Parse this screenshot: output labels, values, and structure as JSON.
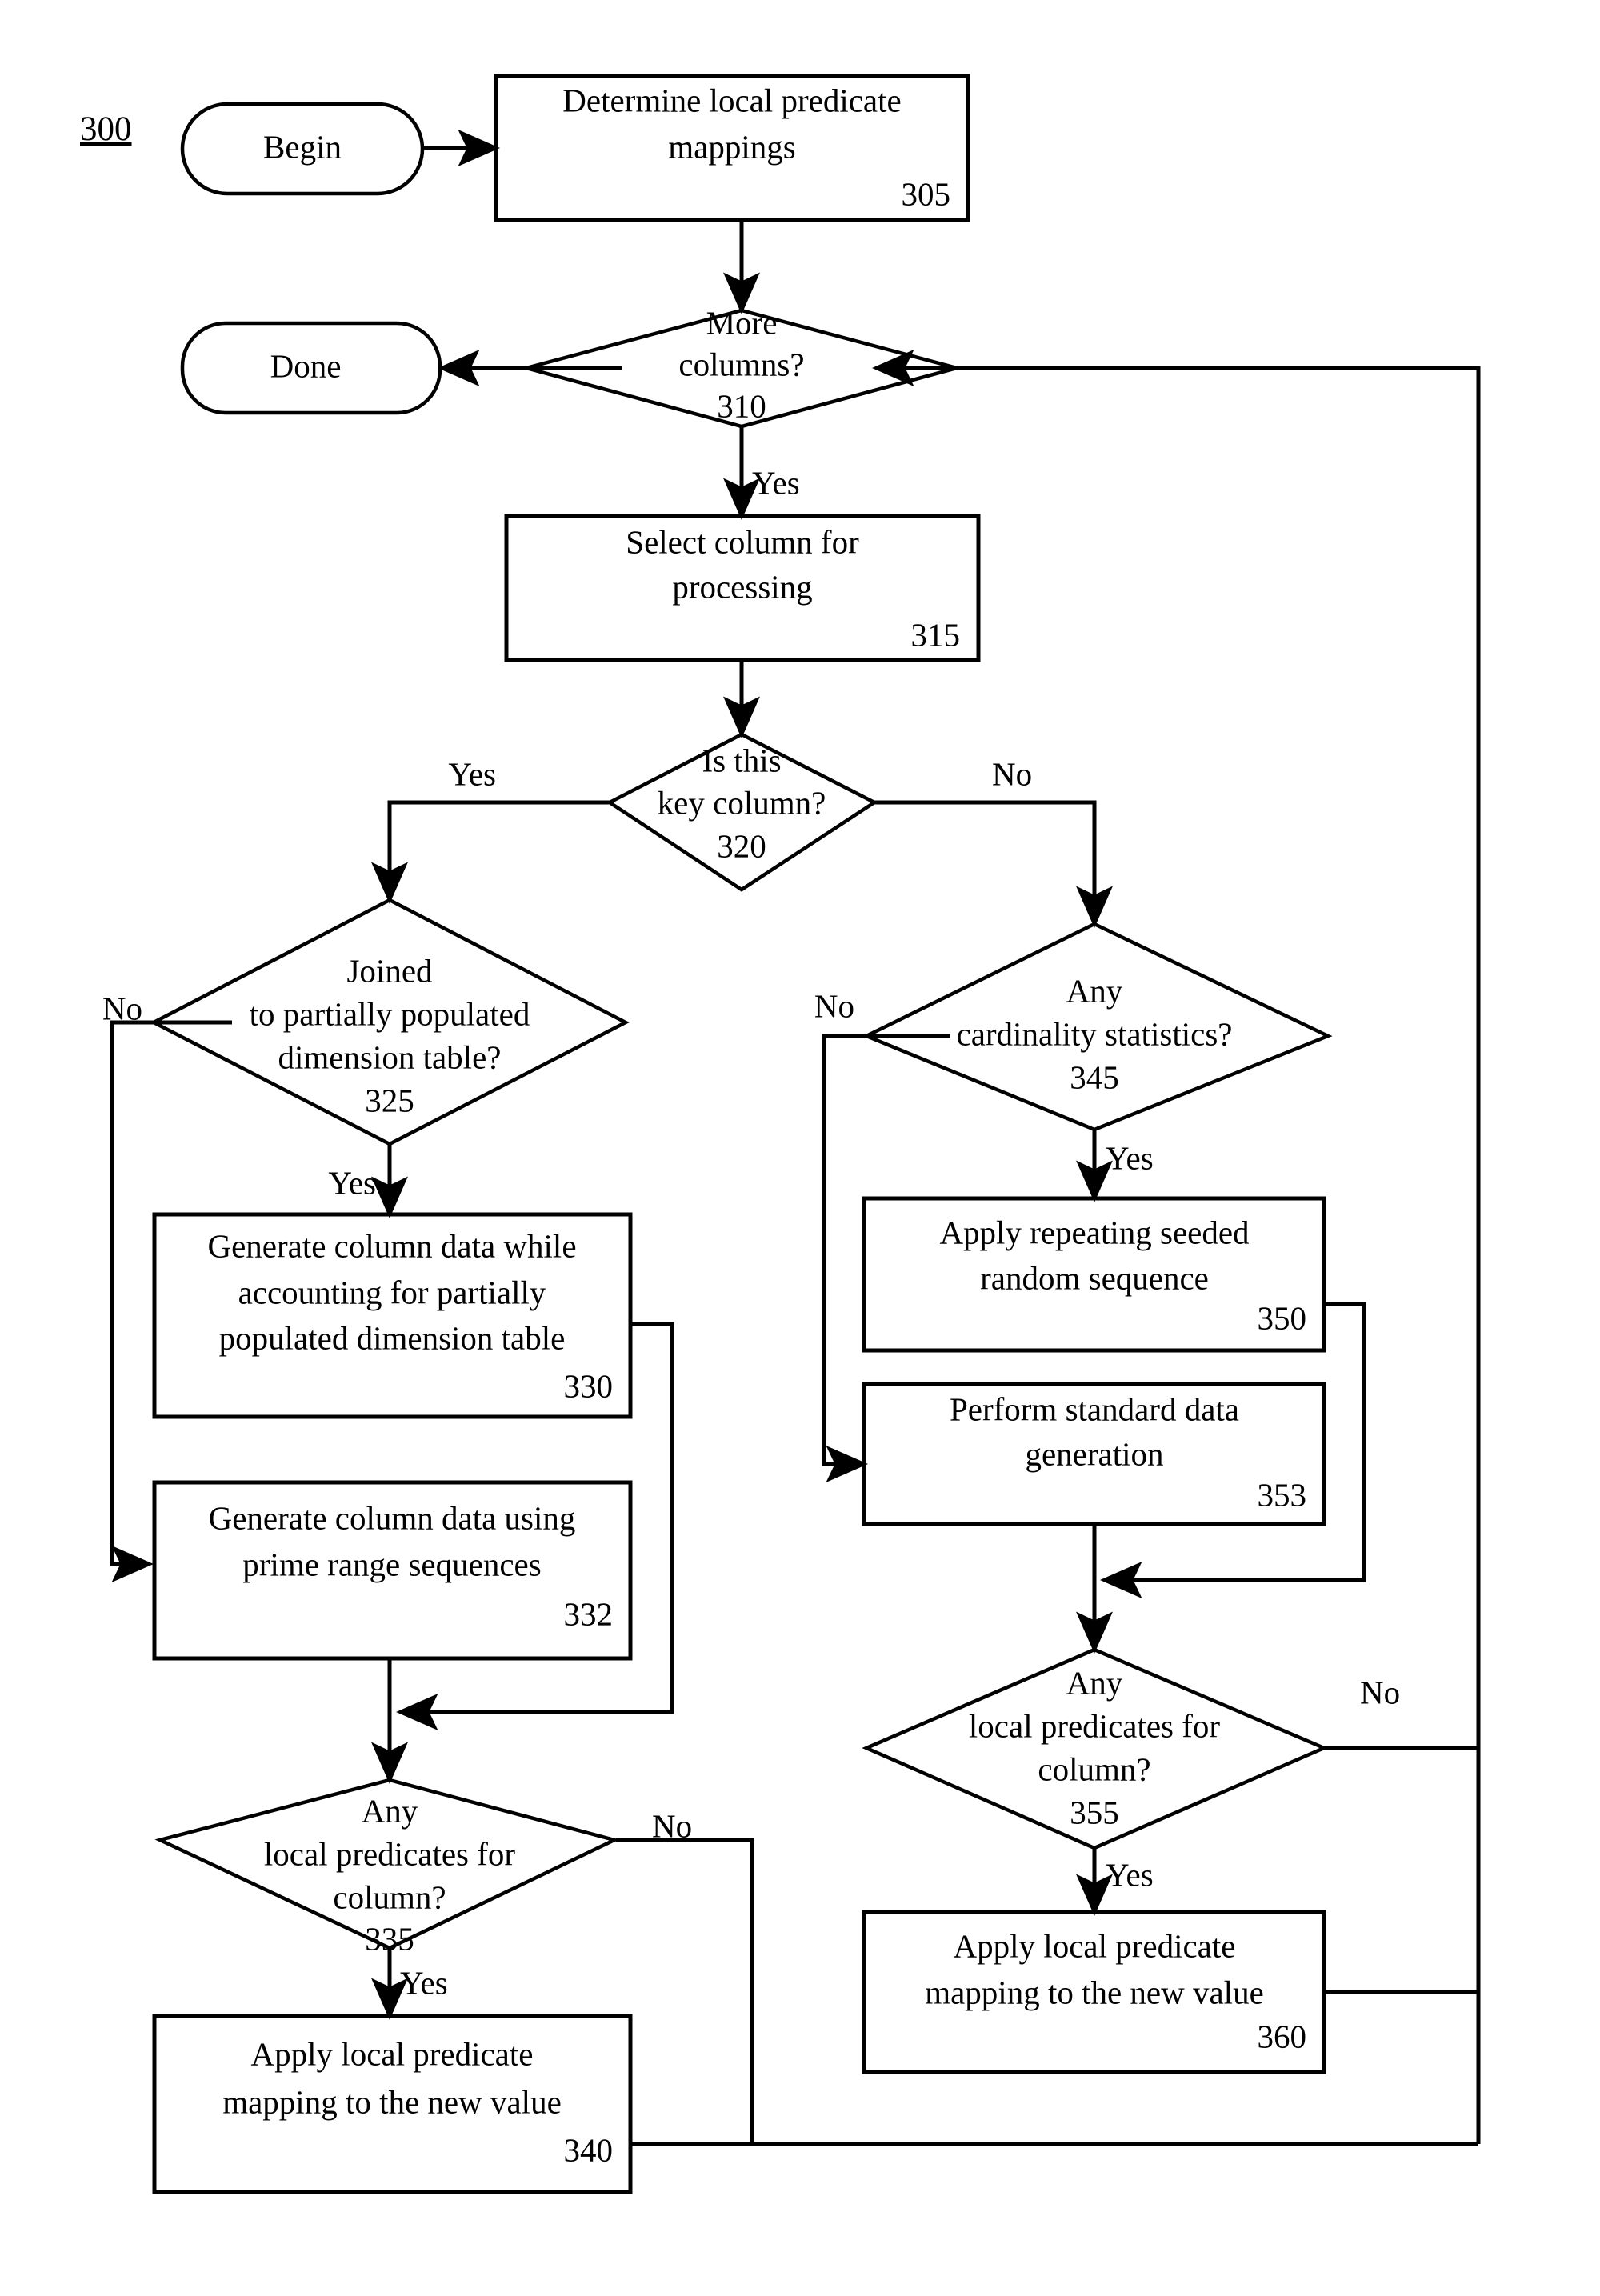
{
  "figure": {
    "label": "300",
    "title_text": ""
  },
  "nodes": {
    "begin": {
      "id": "begin",
      "kind": "terminator",
      "label": "Begin",
      "ref": ""
    },
    "done": {
      "id": "done",
      "kind": "terminator",
      "label": "Done",
      "ref": ""
    },
    "n305": {
      "id": "305",
      "kind": "process",
      "lines": [
        "Determine local predicate",
        "mappings"
      ],
      "ref": "305"
    },
    "n310": {
      "id": "310",
      "kind": "decision",
      "lines": [
        "More",
        "columns?"
      ],
      "ref": "310"
    },
    "n315": {
      "id": "315",
      "kind": "process",
      "lines": [
        "Select column for",
        "processing"
      ],
      "ref": "315"
    },
    "n320": {
      "id": "320",
      "kind": "decision",
      "lines": [
        "Is this",
        "key column?"
      ],
      "ref": "320"
    },
    "n325": {
      "id": "325",
      "kind": "decision",
      "lines": [
        "Joined",
        "to partially populated",
        "dimension table?"
      ],
      "ref": "325"
    },
    "n330": {
      "id": "330",
      "kind": "process",
      "lines": [
        "Generate column data while",
        "accounting for partially",
        "populated dimension table"
      ],
      "ref": "330"
    },
    "n332": {
      "id": "332",
      "kind": "process",
      "lines": [
        "Generate column data using",
        "prime range sequences"
      ],
      "ref": "332"
    },
    "n335": {
      "id": "335",
      "kind": "decision",
      "lines": [
        "Any",
        "local predicates for",
        "column?"
      ],
      "ref": "335"
    },
    "n340": {
      "id": "340",
      "kind": "process",
      "lines": [
        "Apply local predicate",
        "mapping to the new value"
      ],
      "ref": "340"
    },
    "n345": {
      "id": "345",
      "kind": "decision",
      "lines": [
        "Any",
        "cardinality statistics?"
      ],
      "ref": "345"
    },
    "n350": {
      "id": "350",
      "kind": "process",
      "lines": [
        "Apply repeating seeded",
        "random sequence"
      ],
      "ref": "350"
    },
    "n353": {
      "id": "353",
      "kind": "process",
      "lines": [
        "Perform standard data",
        "generation"
      ],
      "ref": "353"
    },
    "n355": {
      "id": "355",
      "kind": "decision",
      "lines": [
        "Any",
        "local predicates for",
        "column?"
      ],
      "ref": "355"
    },
    "n360": {
      "id": "360",
      "kind": "process",
      "lines": [
        "Apply local predicate",
        "mapping to the new value"
      ],
      "ref": "360"
    }
  },
  "edge_labels": {
    "e310_yes": "Yes",
    "e310_no": "",
    "e320_yes": "Yes",
    "e320_no": "No",
    "e325_no": "No",
    "e325_yes": "Yes",
    "e335_no": "No",
    "e335_yes": "Yes",
    "e345_no": "No",
    "e345_yes": "Yes",
    "e355_no": "No",
    "e355_yes": "Yes"
  },
  "colors": {
    "stroke": "#000000",
    "fill": "#ffffff",
    "text": "#000000"
  }
}
